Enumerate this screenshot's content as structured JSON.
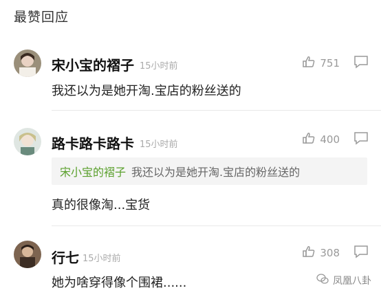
{
  "section_title": "最赞回应",
  "comments": [
    {
      "name": "宋小宝的褶子",
      "time": "15小时前",
      "likes": "751",
      "text": "我还以为是她开淘.宝店的粉丝送的"
    },
    {
      "name": "路卡路卡路卡",
      "time": "15小时前",
      "likes": "400",
      "quote_name": "宋小宝的褶子",
      "quote_text": "我还以为是她开淘.宝店的粉丝送的",
      "text": "真的很像淘...宝货"
    },
    {
      "name": "行七",
      "time": "15小时前",
      "likes": "308",
      "text": "她为啥穿得像个围裙......"
    }
  ],
  "watermark": "凤凰八卦",
  "colors": {
    "quote_name": "#5aa02c",
    "meta": "#aaaaaa"
  },
  "icons": [
    "thumbs-up-icon",
    "comment-bubble-icon",
    "wechat-icon"
  ]
}
